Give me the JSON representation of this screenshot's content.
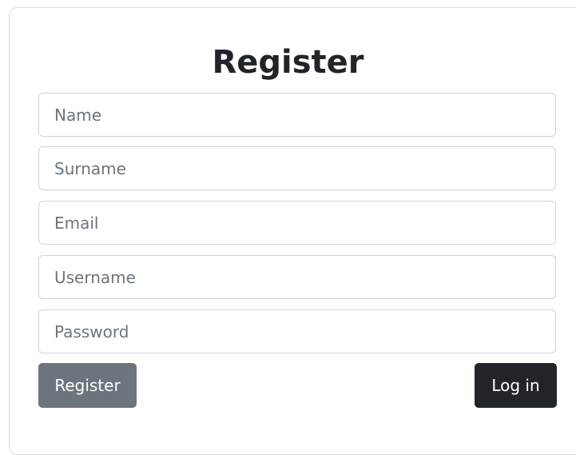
{
  "form": {
    "title": "Register",
    "fields": {
      "name": {
        "value": "",
        "placeholder": "Name"
      },
      "surname": {
        "value": "",
        "placeholder": "Surname"
      },
      "email": {
        "value": "",
        "placeholder": "Email"
      },
      "username": {
        "value": "",
        "placeholder": "Username"
      },
      "password": {
        "value": "",
        "placeholder": "Password"
      }
    },
    "register_label": "Register",
    "login_label": "Log in"
  },
  "colors": {
    "register_button": "#6c757d",
    "login_button": "#212529",
    "input_border": "#ced4da",
    "placeholder_text": "#6c757d"
  }
}
